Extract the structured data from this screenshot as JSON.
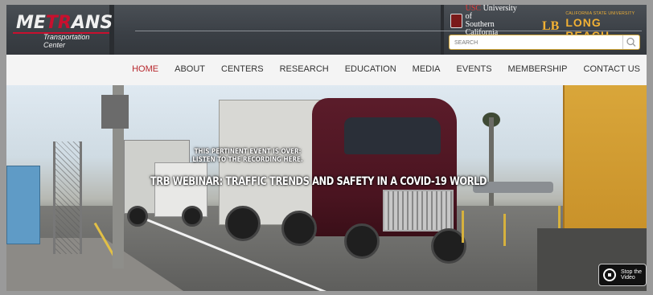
{
  "header": {
    "logo_main_left": "ME",
    "logo_main_accent": "TR",
    "logo_main_right": "ANS",
    "logo_sub": "Transportation Center",
    "usc_line1_a": "USC",
    "usc_line1_b": " University of",
    "usc_line2": "Southern California",
    "csulb_mark": "LB",
    "csulb_small": "CALIFORNIA STATE UNIVERSITY",
    "csulb_large": "LONG BEACH",
    "search_placeholder": "SEARCH"
  },
  "nav": {
    "items": [
      {
        "label": "HOME",
        "active": true
      },
      {
        "label": "ABOUT",
        "active": false
      },
      {
        "label": "CENTERS",
        "active": false
      },
      {
        "label": "RESEARCH",
        "active": false
      },
      {
        "label": "EDUCATION",
        "active": false
      },
      {
        "label": "MEDIA",
        "active": false
      },
      {
        "label": "EVENTS",
        "active": false
      },
      {
        "label": "MEMBERSHIP",
        "active": false
      },
      {
        "label": "CONTACT US",
        "active": false
      }
    ]
  },
  "hero": {
    "caption_line1": "THIS PERTINENT EVENT IS OVER:",
    "caption_line2": "LISTEN TO THE RECORDING HERE.",
    "caption_title": "TRB WEBINAR: TRAFFIC TRENDS AND SAFETY IN A COVID-19 WORLD",
    "stop_video_label": "Stop the Video"
  },
  "colors": {
    "accent_red": "#b8282e",
    "csulb_gold": "#f2b134",
    "header_bg": "#3a3f45"
  },
  "icons": {
    "search": "search-icon",
    "stop": "stop-icon",
    "seal": "usc-seal-icon"
  }
}
